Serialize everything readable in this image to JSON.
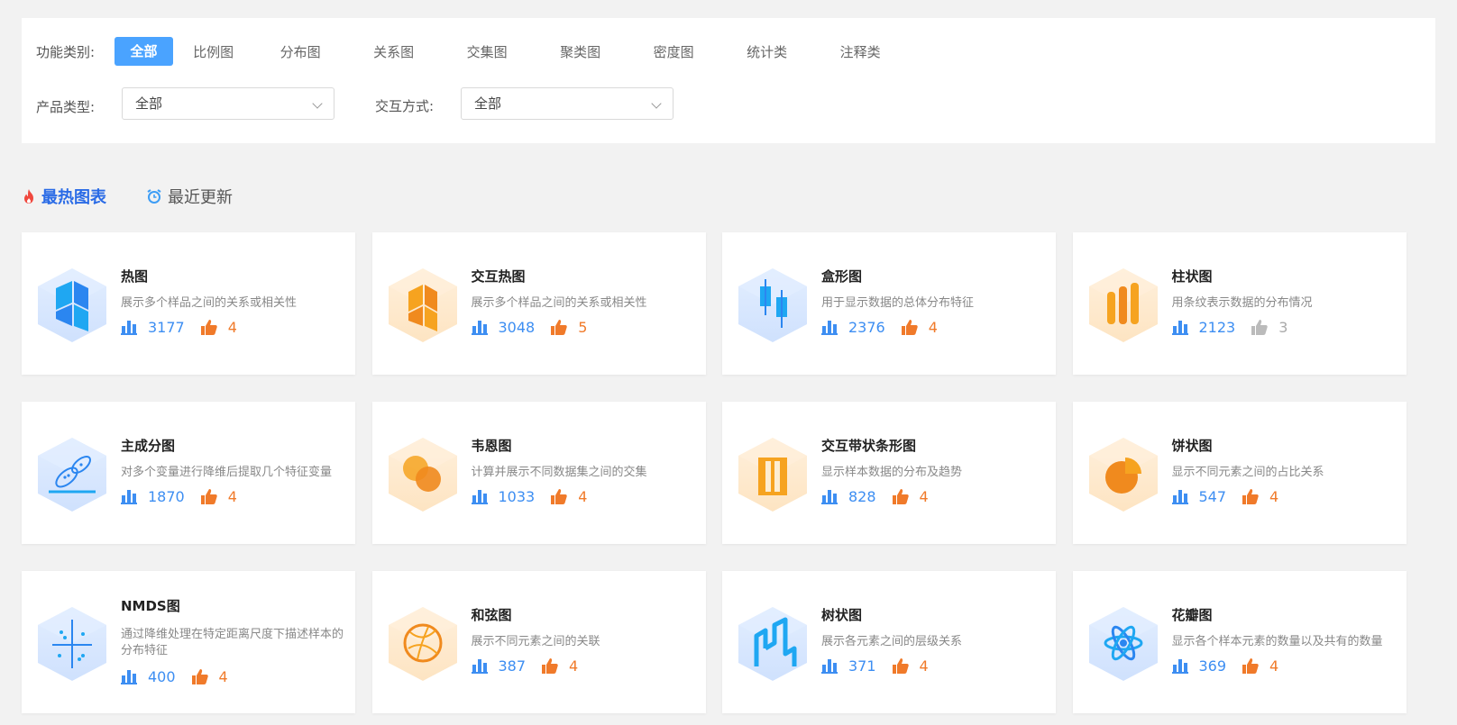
{
  "filters": {
    "category_label": "功能类别:",
    "categories": [
      "全部",
      "比例图",
      "分布图",
      "关系图",
      "交集图",
      "聚类图",
      "密度图",
      "统计类",
      "注释类"
    ],
    "active_category": 0,
    "product_label": "产品类型:",
    "product_value": "全部",
    "interaction_label": "交互方式:",
    "interaction_value": "全部"
  },
  "tabs": {
    "hot": "最热图表",
    "recent": "最近更新"
  },
  "colors": {
    "accent": "#4aa3ff",
    "active_tab": "#2a6be6",
    "views": "#3d8ef2",
    "likes": "#f07a2a"
  },
  "cards": [
    {
      "title": "热图",
      "desc": "展示多个样品之间的关系或相关性",
      "views": "3177",
      "likes": "4",
      "icon": "heatmap-icon",
      "theme": "blue",
      "likes_gray": false
    },
    {
      "title": "交互热图",
      "desc": "展示多个样品之间的关系或相关性",
      "views": "3048",
      "likes": "5",
      "icon": "interactive-heatmap-icon",
      "theme": "orange",
      "likes_gray": false
    },
    {
      "title": "盒形图",
      "desc": "用于显示数据的总体分布特征",
      "views": "2376",
      "likes": "4",
      "icon": "boxplot-icon",
      "theme": "blue",
      "likes_gray": false
    },
    {
      "title": "柱状图",
      "desc": "用条纹表示数据的分布情况",
      "views": "2123",
      "likes": "3",
      "icon": "bar-chart-icon",
      "theme": "orange",
      "likes_gray": true
    },
    {
      "title": "主成分图",
      "desc": "对多个变量进行降维后提取几个特征变量",
      "views": "1870",
      "likes": "4",
      "icon": "pca-icon",
      "theme": "blue",
      "likes_gray": false
    },
    {
      "title": "韦恩图",
      "desc": "计算并展示不同数据集之间的交集",
      "views": "1033",
      "likes": "4",
      "icon": "venn-icon",
      "theme": "orange",
      "likes_gray": false
    },
    {
      "title": "交互带状条形图",
      "desc": "显示样本数据的分布及趋势",
      "views": "828",
      "likes": "4",
      "icon": "ribbon-bar-icon",
      "theme": "orange",
      "likes_gray": false
    },
    {
      "title": "饼状图",
      "desc": "显示不同元素之间的占比关系",
      "views": "547",
      "likes": "4",
      "icon": "pie-chart-icon",
      "theme": "orange",
      "likes_gray": false
    },
    {
      "title": "NMDS图",
      "desc": "通过降维处理在特定距离尺度下描述样本的分布特征",
      "views": "400",
      "likes": "4",
      "icon": "nmds-icon",
      "theme": "blue",
      "likes_gray": false
    },
    {
      "title": "和弦图",
      "desc": "展示不同元素之间的关联",
      "views": "387",
      "likes": "4",
      "icon": "chord-icon",
      "theme": "orange",
      "likes_gray": false
    },
    {
      "title": "树状图",
      "desc": "展示各元素之间的层级关系",
      "views": "371",
      "likes": "4",
      "icon": "tree-icon",
      "theme": "blue",
      "likes_gray": false
    },
    {
      "title": "花瓣图",
      "desc": "显示各个样本元素的数量以及共有的数量",
      "views": "369",
      "likes": "4",
      "icon": "petal-icon",
      "theme": "blue",
      "likes_gray": false
    }
  ]
}
